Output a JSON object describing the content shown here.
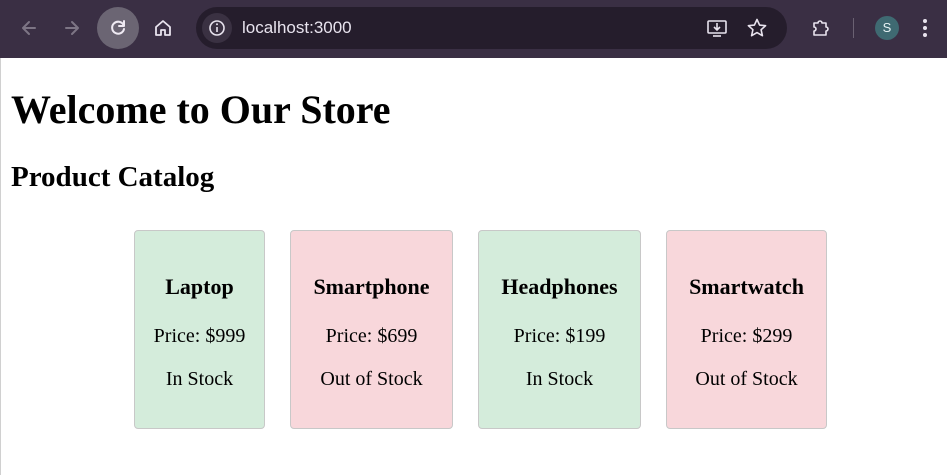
{
  "browser": {
    "url": "localhost:3000",
    "profile_initial": "S",
    "icons": {
      "back": "arrow-left-icon",
      "forward": "arrow-right-icon",
      "reload": "reload-icon",
      "home": "home-icon",
      "site_info": "info-icon",
      "install": "install-app-icon",
      "bookmark": "star-icon",
      "extensions": "puzzle-icon",
      "menu": "kebab-menu-icon"
    }
  },
  "page": {
    "title": "Welcome to Our Store",
    "subtitle": "Product Catalog"
  },
  "products": [
    {
      "name": "Laptop",
      "price": "Price: $999",
      "stock": "In Stock",
      "status": "in"
    },
    {
      "name": "Smartphone",
      "price": "Price: $699",
      "stock": "Out of Stock",
      "status": "out"
    },
    {
      "name": "Headphones",
      "price": "Price: $199",
      "stock": "In Stock",
      "status": "in"
    },
    {
      "name": "Smartwatch",
      "price": "Price: $299",
      "stock": "Out of Stock",
      "status": "out"
    }
  ],
  "colors": {
    "toolbar": "#3a2f44",
    "omnibox": "#251d2c",
    "in_stock_bg": "#d4ecdb",
    "out_of_stock_bg": "#f8d7db"
  }
}
